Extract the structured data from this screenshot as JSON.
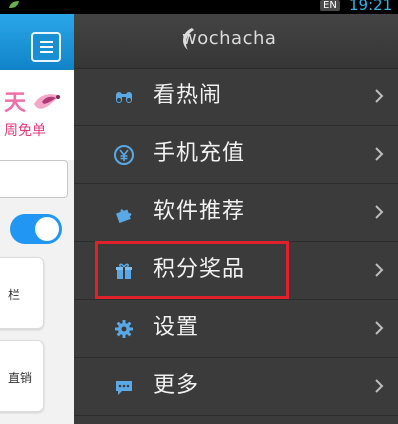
{
  "status_bar": {
    "language": "EN",
    "time": "19:21",
    "app_icon": "leaf-icon"
  },
  "background_page": {
    "menu_button_icon": "hamburger-menu-icon",
    "promo_text_big": "天",
    "promo_text_small": "周免单",
    "card_1_text": "栏",
    "card_2_text": "直销",
    "toggle_on": true
  },
  "drawer": {
    "brand": "wochacha",
    "items": [
      {
        "label": "看热闹",
        "icon": "binoculars-icon"
      },
      {
        "label": "手机充值",
        "icon": "yuan-coin-icon"
      },
      {
        "label": "软件推荐",
        "icon": "puzzle-icon"
      },
      {
        "label": "积分奖品",
        "icon": "gift-icon",
        "highlighted": true
      },
      {
        "label": "设置",
        "icon": "gear-icon"
      },
      {
        "label": "更多",
        "icon": "chat-bubble-icon"
      }
    ]
  },
  "colors": {
    "accent_blue": "#1e9ee6",
    "clock_blue": "#33b5e5",
    "drawer_bg": "#3b3b3b",
    "icon_blue": "#5aa9e6",
    "highlight_red": "#e0202a",
    "promo_pink": "#f06ea9"
  }
}
